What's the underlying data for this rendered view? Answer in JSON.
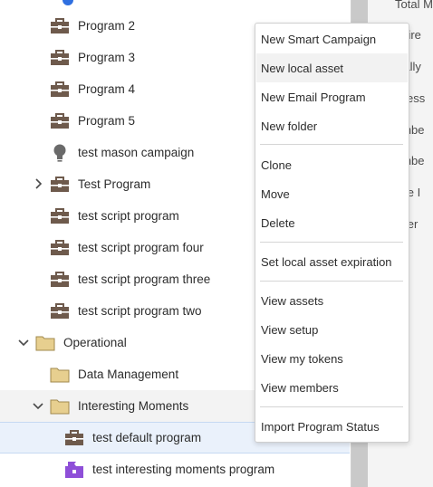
{
  "tree": {
    "items": [
      {
        "label": "Program 2",
        "icon": "program-icon"
      },
      {
        "label": "Program 3",
        "icon": "program-icon"
      },
      {
        "label": "Program 4",
        "icon": "program-icon"
      },
      {
        "label": "Program 5",
        "icon": "program-icon"
      },
      {
        "label": "test mason campaign",
        "icon": "smart-campaign-icon"
      },
      {
        "label": "Test Program",
        "icon": "program-icon"
      },
      {
        "label": "test script program",
        "icon": "program-icon"
      },
      {
        "label": "test script program four",
        "icon": "program-icon"
      },
      {
        "label": "test script program three",
        "icon": "program-icon"
      },
      {
        "label": "test script program two",
        "icon": "program-icon"
      },
      {
        "label": "Operational",
        "icon": "folder-icon"
      },
      {
        "label": "Data Management",
        "icon": "folder-icon"
      },
      {
        "label": "Interesting Moments",
        "icon": "folder-icon"
      },
      {
        "label": "test default program",
        "icon": "program-icon"
      },
      {
        "label": "test interesting moments program",
        "icon": "event-program-icon"
      }
    ]
  },
  "context_menu": {
    "items": [
      "New Smart Campaign",
      "New local asset",
      "New Email Program",
      "New folder",
      "Clone",
      "Move",
      "Delete",
      "Set local asset expiration",
      "View assets",
      "View setup",
      "View my tokens",
      "View members",
      "Import Program Status"
    ]
  },
  "right_panel": {
    "fragments": [
      "Total M",
      "quire",
      "cially",
      "ccess",
      "embe",
      "embe",
      "lete I",
      "nver"
    ]
  },
  "colors": {
    "program_icon": "#6e5a4c",
    "folder_fill": "#e7cf8f",
    "folder_stroke": "#a08a4e",
    "event_program_icon": "#8e4fd8",
    "selected_row": "#eaf1fb",
    "divider": "#c9c9c9"
  }
}
